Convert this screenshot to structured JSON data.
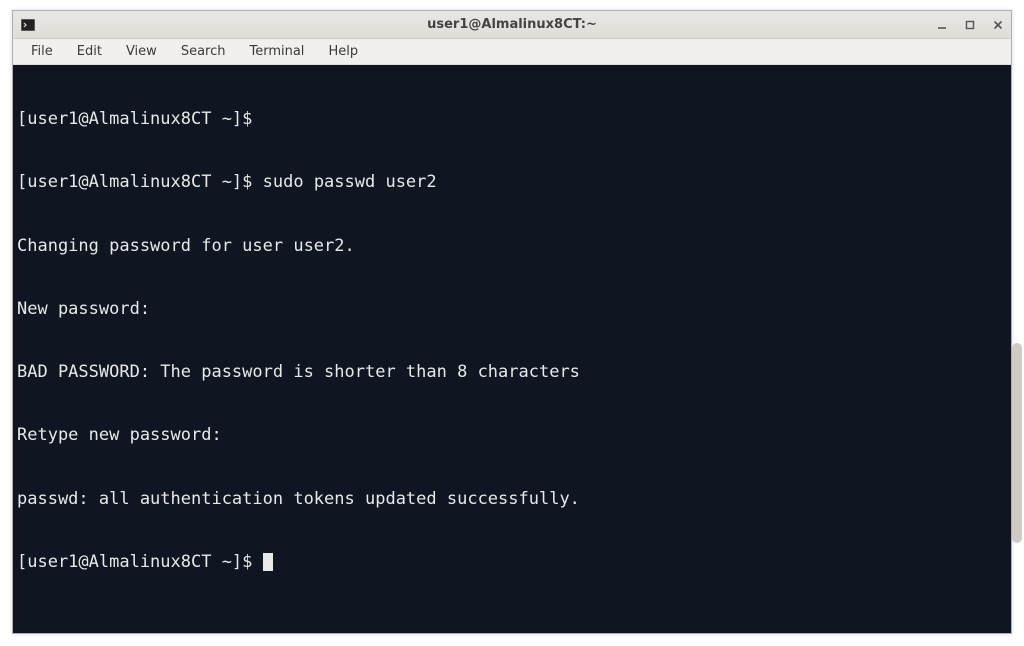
{
  "window": {
    "title": "user1@Almalinux8CT:~"
  },
  "menubar": {
    "items": [
      {
        "label": "File"
      },
      {
        "label": "Edit"
      },
      {
        "label": "View"
      },
      {
        "label": "Search"
      },
      {
        "label": "Terminal"
      },
      {
        "label": "Help"
      }
    ]
  },
  "terminal": {
    "lines": [
      {
        "prompt": "[user1@Almalinux8CT ~]$",
        "command": ""
      },
      {
        "prompt": "[user1@Almalinux8CT ~]$",
        "command": " sudo passwd user2"
      },
      {
        "text": "Changing password for user user2."
      },
      {
        "text": "New password:"
      },
      {
        "text": "BAD PASSWORD: The password is shorter than 8 characters"
      },
      {
        "text": "Retype new password:"
      },
      {
        "text": "passwd: all authentication tokens updated successfully."
      },
      {
        "prompt": "[user1@Almalinux8CT ~]$ ",
        "cursor": true
      }
    ]
  },
  "colors": {
    "terminal_bg": "#0f1621",
    "terminal_fg": "#e8e8e8",
    "titlebar_bg": "#e0ddd9"
  }
}
